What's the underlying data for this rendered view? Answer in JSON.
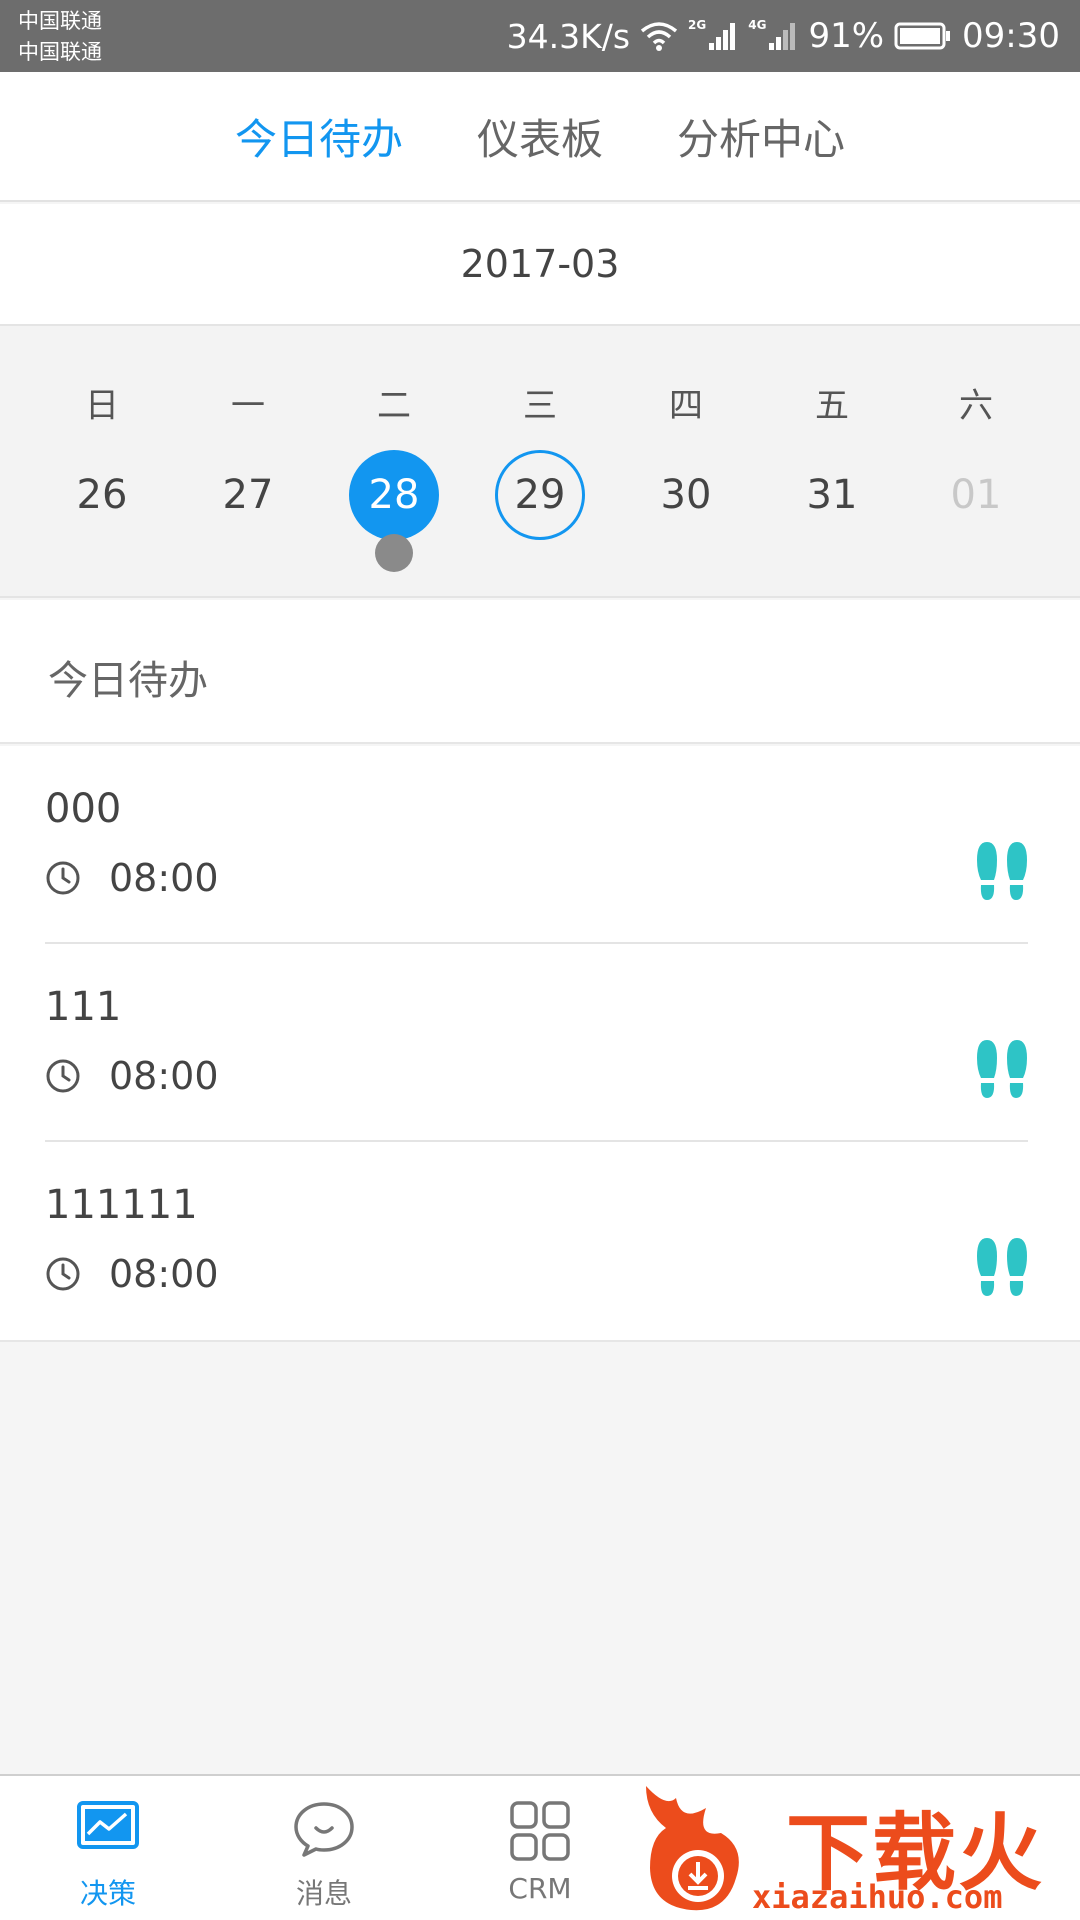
{
  "status_bar": {
    "carrier_1": "中国联通",
    "carrier_2": "中国联通",
    "net_speed": "34.3K/s",
    "tag_2g": "2G",
    "tag_4g": "4G",
    "battery": "91%",
    "time": "09:30"
  },
  "top_tabs": [
    {
      "label": "今日待办",
      "active": true
    },
    {
      "label": "仪表板",
      "active": false
    },
    {
      "label": "分析中心",
      "active": false
    }
  ],
  "calendar": {
    "month": "2017-03",
    "days": [
      {
        "weekday": "日",
        "date": "26"
      },
      {
        "weekday": "一",
        "date": "27"
      },
      {
        "weekday": "二",
        "date": "28",
        "state": "selected",
        "has_event": true
      },
      {
        "weekday": "三",
        "date": "29",
        "state": "today"
      },
      {
        "weekday": "四",
        "date": "30"
      },
      {
        "weekday": "五",
        "date": "31"
      },
      {
        "weekday": "六",
        "date": "01",
        "state": "dim"
      }
    ]
  },
  "section": {
    "title": "今日待办"
  },
  "todos": [
    {
      "title": "000",
      "time": "08:00",
      "icon": "footprints-icon"
    },
    {
      "title": "111",
      "time": "08:00",
      "icon": "footprints-icon"
    },
    {
      "title": "111111",
      "time": "08:00",
      "icon": "footprints-icon"
    }
  ],
  "bottom_nav": [
    {
      "label": "决策",
      "icon": "chart-icon",
      "active": true
    },
    {
      "label": "消息",
      "icon": "chat-icon",
      "active": false
    },
    {
      "label": "CRM",
      "icon": "grid-icon",
      "active": false
    }
  ],
  "watermark": {
    "text": "下载火",
    "url": "xiazaihuo.com"
  },
  "colors": {
    "accent": "#1296f0",
    "icon_teal": "#2ec4c6",
    "watermark": "#ec4c1c"
  }
}
